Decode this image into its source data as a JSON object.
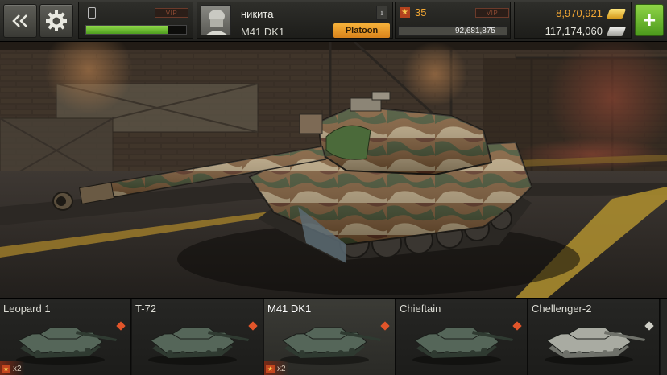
{
  "header": {
    "vip_label": "VIP",
    "xp_progress": 0.82,
    "player": {
      "name": "никита",
      "tank": "M41 DK1",
      "info_label": "i",
      "platoon_label": "Platoon"
    },
    "level": "35",
    "experience": "92,681,875",
    "gold": "8,970,921",
    "silver": "117,174,060",
    "add_label": "+"
  },
  "carousel": {
    "tanks": [
      {
        "name": "Leopard 1",
        "count": "x2",
        "rank_color": "#e2552a",
        "selected": false
      },
      {
        "name": "T-72",
        "count": "",
        "rank_color": "#e2552a",
        "selected": false
      },
      {
        "name": "M41 DK1",
        "count": "x2",
        "rank_color": "#e2552a",
        "selected": true
      },
      {
        "name": "Chieftain",
        "count": "",
        "rank_color": "#e2552a",
        "selected": false
      },
      {
        "name": "Chellenger-2",
        "count": "",
        "rank_color": "#cfcfc7",
        "selected": false
      }
    ]
  },
  "colors": {
    "gold": "#f1a634",
    "accent_green": "#6cc232",
    "platoon_orange": "#f1a634"
  },
  "icons": [
    "back-chevrons-icon",
    "gear-icon",
    "xp-icon",
    "star-icon",
    "gold-ingot-icon",
    "silver-ingot-icon",
    "plus-icon",
    "info-icon",
    "tank-silhouette-icon"
  ]
}
